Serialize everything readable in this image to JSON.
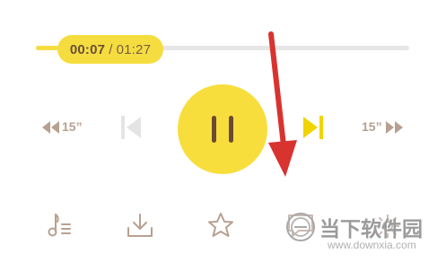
{
  "player": {
    "current_time": "00:07",
    "separator": "/",
    "total_time": "01:27",
    "progress": 0.06
  },
  "controls": {
    "rewind_label": "15”",
    "forward_label": "15”",
    "play_state": "pause-icon",
    "previous_icon": "skip-previous-icon",
    "next_icon": "skip-next-icon"
  },
  "bottom_bar": {
    "icons": [
      "playlist-icon",
      "download-icon",
      "star-icon",
      "comment-icon",
      "settings-icon"
    ]
  },
  "watermark": {
    "title": "当下软件园",
    "url": "www.downxia.com"
  },
  "colors": {
    "accent": "#f8de3c",
    "pause_bars": "#6b4a33",
    "muted_icon": "#b7a091",
    "next_icon": "#f1d400",
    "arrow": "#d8332f"
  }
}
